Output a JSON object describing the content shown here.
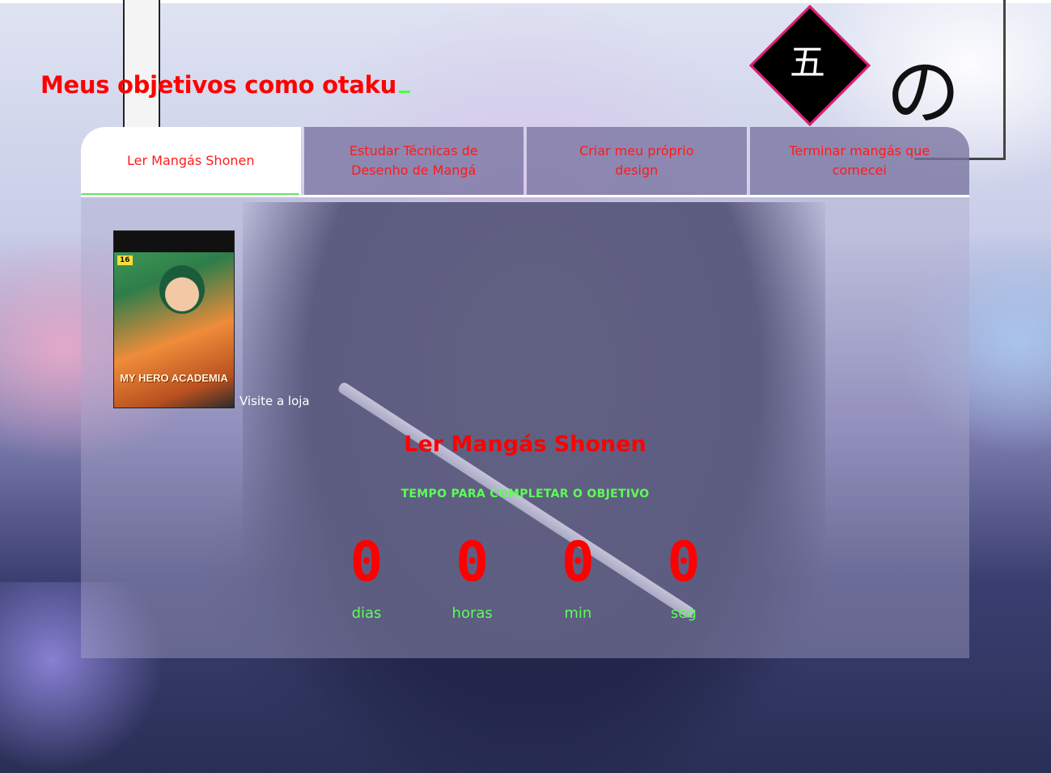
{
  "header": {
    "title": "Meus objetivos como otaku"
  },
  "tabs": [
    {
      "label": "Ler Mangás Shonen",
      "active": true
    },
    {
      "label": "Estudar Técnicas de Desenho de Mangá",
      "active": false
    },
    {
      "label": "Criar meu próprio design",
      "active": false
    },
    {
      "label": "Terminar mangás que comecei",
      "active": false
    }
  ],
  "panel": {
    "store": {
      "link_label": "Visite a loja",
      "cover_title": "MY HERO ACADEMIA",
      "cover_issue": "16"
    },
    "goal_title": "Ler Mangás Shonen",
    "goal_subtitle": "TEMPO PARA COMPLETAR O OBJETIVO",
    "countdown": [
      {
        "value": "0",
        "label": "dias"
      },
      {
        "value": "0",
        "label": "horas"
      },
      {
        "value": "0",
        "label": "min"
      },
      {
        "value": "0",
        "label": "seg"
      }
    ]
  },
  "background": {
    "kanji": "五",
    "kana": "の"
  },
  "colors": {
    "title": "#ff0000",
    "accent_green": "#5cff55",
    "active_tab_indicator": "#63e06b",
    "active_tab_bg": "#ffffff"
  }
}
